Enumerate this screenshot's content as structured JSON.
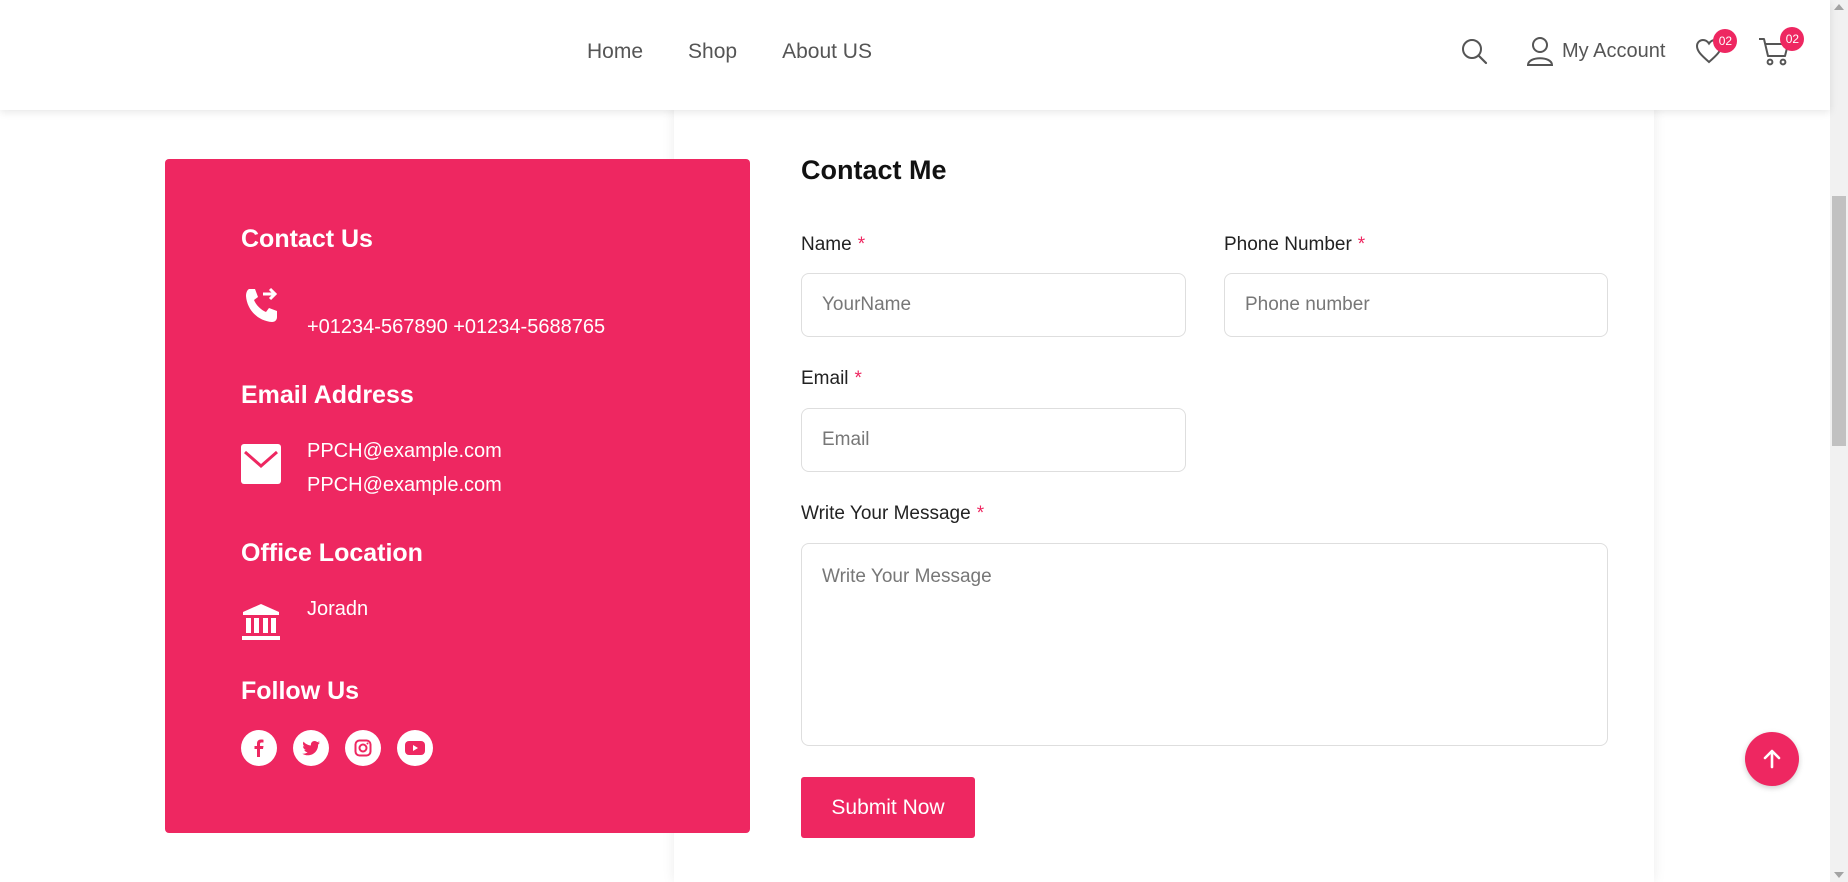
{
  "header": {
    "nav": [
      "Home",
      "Shop",
      "About US"
    ],
    "account_label": "My Account",
    "wishlist_count": "02",
    "cart_count": "02"
  },
  "contact_info": {
    "contact_title": "Contact Us",
    "phones": "+01234-567890 +01234-5688765",
    "email_title": "Email Address",
    "email_1": "PPCH@example.com",
    "email_2": "PPCH@example.com",
    "office_title": "Office Location",
    "office": "Joradn",
    "follow_title": "Follow Us"
  },
  "form": {
    "title": "Contact Me",
    "name_label": "Name",
    "name_placeholder": "YourName",
    "phone_label": "Phone Number",
    "phone_placeholder": "Phone number",
    "email_label": "Email",
    "email_placeholder": "Email",
    "message_label": "Write Your Message",
    "message_placeholder": "Write Your Message",
    "required_mark": "*",
    "submit_label": "Submit Now"
  },
  "colors": {
    "accent": "#ee2761"
  }
}
